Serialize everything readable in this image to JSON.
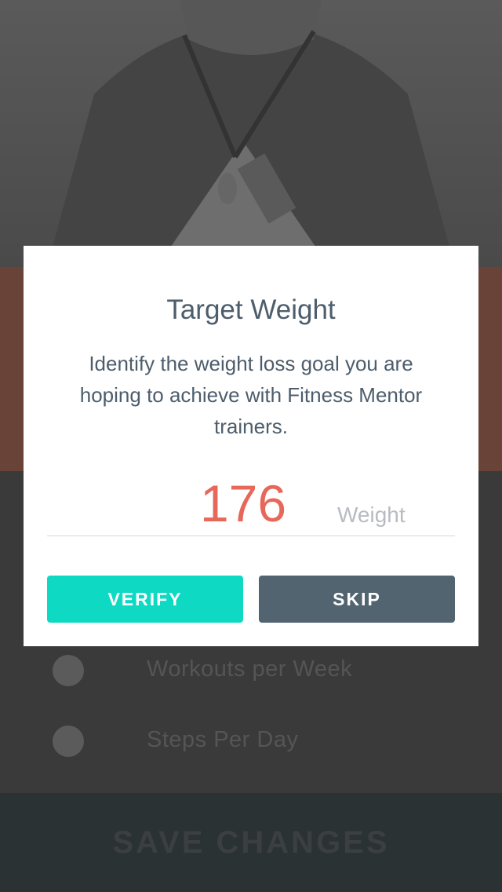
{
  "background": {
    "list_items": [
      {
        "label": "Workouts per Week"
      },
      {
        "label": "Steps Per Day"
      }
    ],
    "save_label": "SAVE CHANGES"
  },
  "modal": {
    "title": "Target Weight",
    "description": "Identify the weight loss goal you are hoping to achieve with Fitness Mentor trainers.",
    "weight_value": "176",
    "weight_unit": "Weight",
    "verify_label": "VERIFY",
    "skip_label": "SKIP"
  },
  "colors": {
    "accent_teal": "#0ed9c3",
    "button_slate": "#526470",
    "value_red": "#e7685a",
    "text_slate": "#4d5d6c"
  }
}
